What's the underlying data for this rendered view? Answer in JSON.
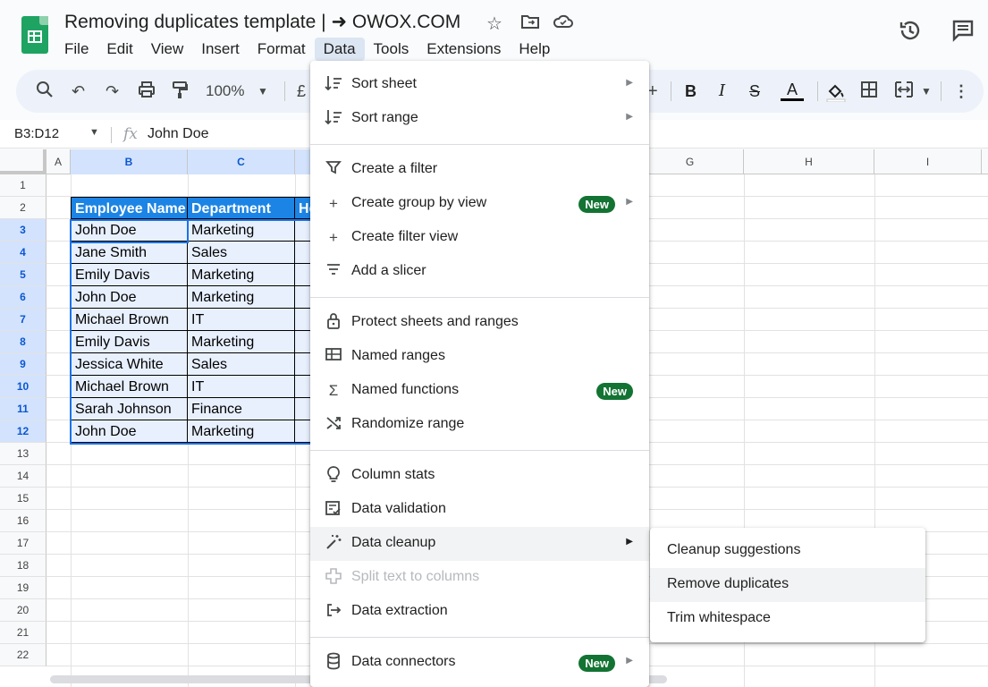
{
  "header": {
    "title": "Removing duplicates template | ➜ OWOX.COM",
    "menu": [
      "File",
      "Edit",
      "View",
      "Insert",
      "Format",
      "Data",
      "Tools",
      "Extensions",
      "Help"
    ],
    "active_menu": "Data"
  },
  "toolbar": {
    "zoom": "100%",
    "currency": "£"
  },
  "formula_bar": {
    "name_box": "B3:D12",
    "fx": "fx",
    "value": "John Doe"
  },
  "grid": {
    "columns": [
      "A",
      "B",
      "C",
      "G",
      "H",
      "I"
    ],
    "rows": [
      "1",
      "2",
      "3",
      "4",
      "5",
      "6",
      "7",
      "8",
      "9",
      "10",
      "11",
      "12",
      "13",
      "14",
      "15",
      "16",
      "17",
      "18",
      "19",
      "20",
      "21",
      "22"
    ],
    "table_headers": [
      "Employee Name",
      "Department",
      "He"
    ],
    "table_rows": [
      [
        "John Doe",
        "Marketing"
      ],
      [
        "Jane Smith",
        "Sales"
      ],
      [
        "Emily Davis",
        "Marketing"
      ],
      [
        "John Doe",
        "Marketing"
      ],
      [
        "Michael Brown",
        "IT"
      ],
      [
        "Emily Davis",
        "Marketing"
      ],
      [
        "Jessica White",
        "Sales"
      ],
      [
        "Michael Brown",
        "IT"
      ],
      [
        "Sarah Johnson",
        "Finance"
      ],
      [
        "John Doe",
        "Marketing"
      ]
    ]
  },
  "data_menu": {
    "items": [
      {
        "label": "Sort sheet",
        "icon": "sort-icon",
        "submenu": true
      },
      {
        "label": "Sort range",
        "icon": "sort-icon",
        "submenu": true
      },
      {
        "label": "Create a filter",
        "icon": "filter-icon"
      },
      {
        "label": "Create group by view",
        "icon": "plus-icon",
        "badge": "New",
        "submenu": true
      },
      {
        "label": "Create filter view",
        "icon": "plus-icon"
      },
      {
        "label": "Add a slicer",
        "icon": "slicer-icon"
      },
      {
        "label": "Protect sheets and ranges",
        "icon": "lock-icon"
      },
      {
        "label": "Named ranges",
        "icon": "table-icon"
      },
      {
        "label": "Named functions",
        "icon": "sigma-icon",
        "badge": "New"
      },
      {
        "label": "Randomize range",
        "icon": "shuffle-icon"
      },
      {
        "label": "Column stats",
        "icon": "lightbulb-icon"
      },
      {
        "label": "Data validation",
        "icon": "validation-icon"
      },
      {
        "label": "Data cleanup",
        "icon": "magic-wand-icon",
        "submenu": true,
        "highlight": true
      },
      {
        "label": "Split text to columns",
        "icon": "split-icon",
        "disabled": true
      },
      {
        "label": "Data extraction",
        "icon": "extract-icon"
      },
      {
        "label": "Data connectors",
        "icon": "database-icon",
        "badge": "New",
        "submenu": true
      }
    ]
  },
  "cleanup_submenu": {
    "items": [
      "Cleanup suggestions",
      "Remove duplicates",
      "Trim whitespace"
    ],
    "highlighted": "Remove duplicates"
  }
}
